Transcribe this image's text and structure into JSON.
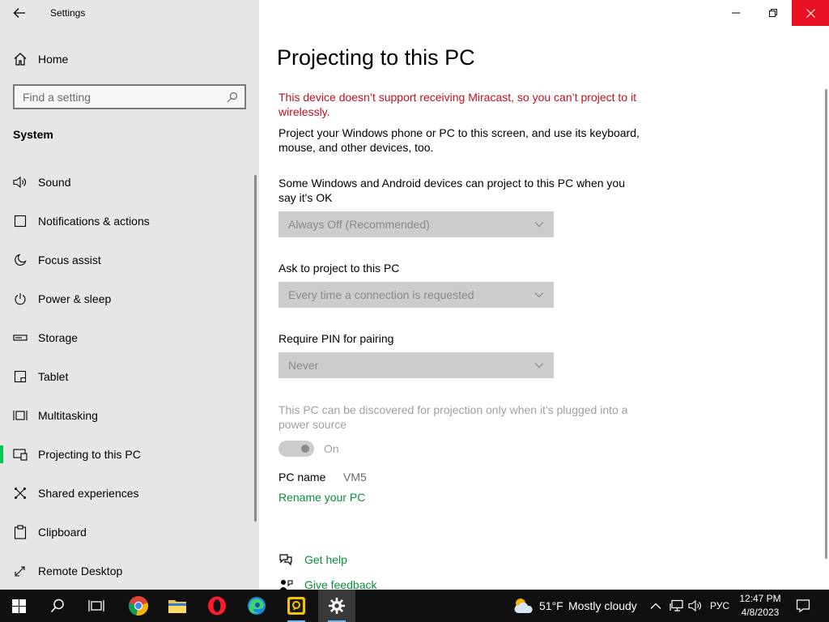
{
  "window": {
    "app_title": "Settings"
  },
  "sidebar": {
    "home_label": "Home",
    "search_placeholder": "Find a setting",
    "section_title": "System",
    "items": [
      {
        "label": "Sound",
        "icon": "speaker-icon"
      },
      {
        "label": "Notifications & actions",
        "icon": "notification-icon"
      },
      {
        "label": "Focus assist",
        "icon": "moon-icon"
      },
      {
        "label": "Power & sleep",
        "icon": "power-icon"
      },
      {
        "label": "Storage",
        "icon": "storage-icon"
      },
      {
        "label": "Tablet",
        "icon": "tablet-icon"
      },
      {
        "label": "Multitasking",
        "icon": "multitasking-icon"
      },
      {
        "label": "Projecting to this PC",
        "icon": "projector-icon",
        "selected": true
      },
      {
        "label": "Shared experiences",
        "icon": "shared-icon"
      },
      {
        "label": "Clipboard",
        "icon": "clipboard-icon"
      },
      {
        "label": "Remote Desktop",
        "icon": "remote-desktop-icon"
      }
    ]
  },
  "main": {
    "title": "Projecting to this PC",
    "warning": "This device doesn’t support receiving Miracast, so you can’t project to it wirelessly.",
    "description": "Project your Windows phone or PC to this screen, and use its keyboard, mouse, and other devices, too.",
    "project_permission_label": "Some Windows and Android devices can project to this PC when you say it's OK",
    "project_permission_value": "Always Off (Recommended)",
    "ask_label": "Ask to project to this PC",
    "ask_value": "Every time a connection is requested",
    "pin_label": "Require PIN for pairing",
    "pin_value": "Never",
    "plugged_in_note": "This PC can be discovered for projection only when it's plugged into a power source",
    "plugged_in_toggle_label": "On",
    "pc_name_label": "PC name",
    "pc_name_value": "VM5",
    "rename_link": "Rename your PC",
    "get_help": "Get help",
    "give_feedback": "Give feedback"
  },
  "taskbar": {
    "weather_temp": "51°F",
    "weather_desc": "Mostly cloudy",
    "language": "РУС",
    "time": "12:47 PM",
    "date": "4/8/2023"
  },
  "colors": {
    "accent": "#00c853",
    "link": "#0a8f3c",
    "warning": "#c50f1f",
    "close_button": "#e81123",
    "sidebar_bg": "#e6e6e6",
    "taskbar_bg": "#101010"
  }
}
